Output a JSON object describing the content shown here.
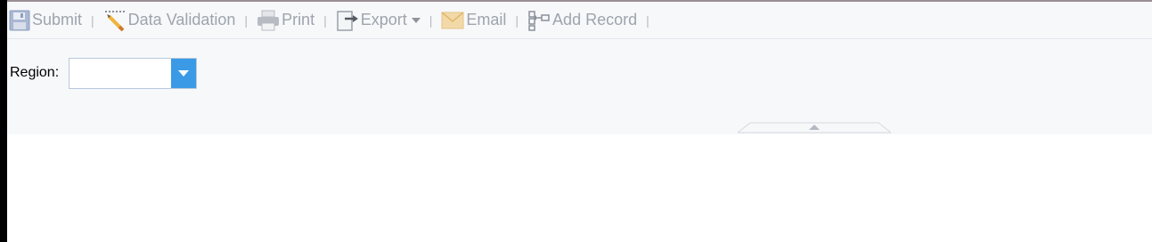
{
  "toolbar": {
    "items": [
      {
        "label": "Submit",
        "icon": "floppy-disk-icon"
      },
      {
        "label": "Data Validation",
        "icon": "pencil-ruler-icon"
      },
      {
        "label": "Print",
        "icon": "printer-icon"
      },
      {
        "label": "Export",
        "icon": "export-icon",
        "has_dropdown": true
      },
      {
        "label": "Email",
        "icon": "envelope-icon"
      },
      {
        "label": "Add Record",
        "icon": "add-record-icon"
      }
    ],
    "separator": "|"
  },
  "form": {
    "region_label": "Region:",
    "region_value": ""
  },
  "colors": {
    "toolbar_text": "#9ea4ad",
    "dropdown_button": "#3a9ae6",
    "panel_background": "#f7f8fa"
  }
}
